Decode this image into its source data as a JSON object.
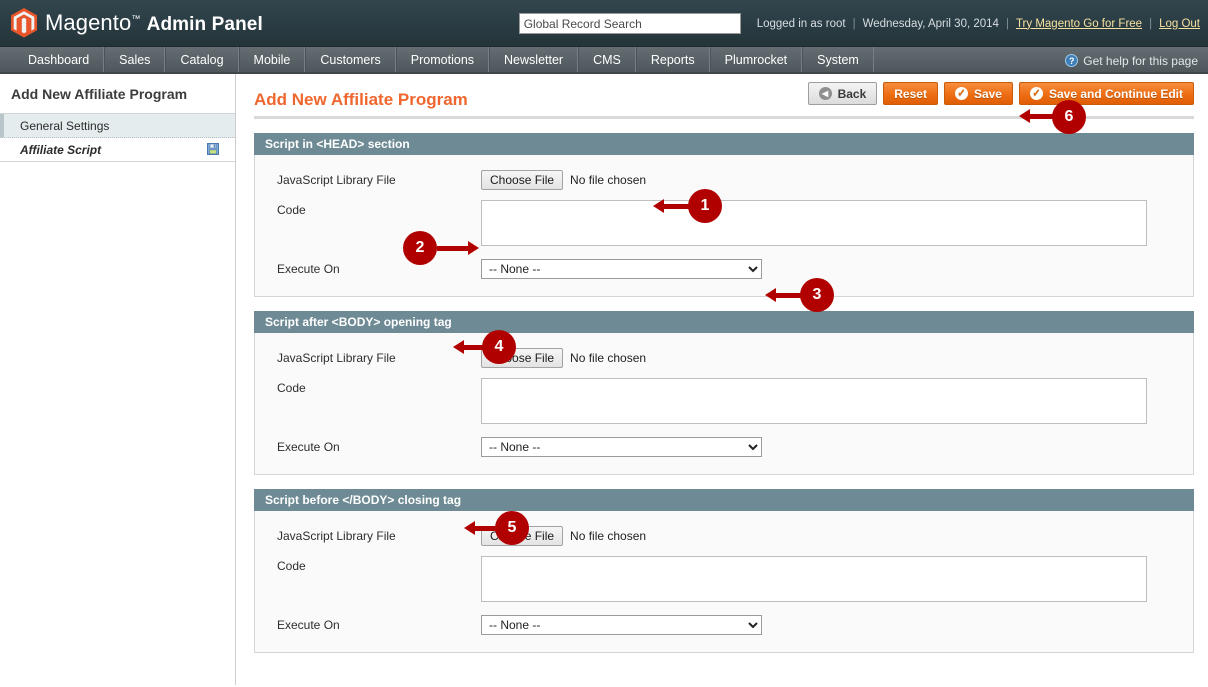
{
  "header": {
    "logo_text_brand": "Magento",
    "logo_tm": "™",
    "logo_text_sub": "Admin Panel",
    "search_placeholder": "Global Record Search",
    "search_value": "Global Record Search",
    "logged_in": "Logged in as root",
    "separator": "|",
    "date": "Wednesday, April 30, 2014",
    "try_link": "Try Magento Go for Free",
    "logout_link": "Log Out"
  },
  "nav": {
    "items": [
      {
        "label": "Dashboard"
      },
      {
        "label": "Sales"
      },
      {
        "label": "Catalog"
      },
      {
        "label": "Mobile"
      },
      {
        "label": "Customers"
      },
      {
        "label": "Promotions"
      },
      {
        "label": "Newsletter"
      },
      {
        "label": "CMS"
      },
      {
        "label": "Reports"
      },
      {
        "label": "Plumrocket"
      },
      {
        "label": "System"
      }
    ],
    "help_label": "Get help for this page",
    "help_icon": "question-mark-icon"
  },
  "sidebar": {
    "title": "Add New Affiliate Program",
    "items": [
      {
        "label": "General Settings",
        "state": "active"
      },
      {
        "label": "Affiliate Script",
        "state": "current",
        "icon": "save-disk-icon"
      }
    ]
  },
  "page": {
    "title": "Add New Affiliate Program",
    "buttons": [
      {
        "label": "Back",
        "style": "grey",
        "icon": "back-arrow-icon"
      },
      {
        "label": "Reset",
        "style": "orange",
        "icon": "none"
      },
      {
        "label": "Save",
        "style": "orange",
        "icon": "check-circle-icon"
      },
      {
        "label": "Save and Continue Edit",
        "style": "orange",
        "icon": "check-circle-icon"
      }
    ]
  },
  "fieldsets": [
    {
      "heading": "Script in <HEAD> section",
      "rows": [
        {
          "label": "JavaScript Library File",
          "type": "file",
          "button": "Choose File",
          "status": "No file chosen"
        },
        {
          "label": "Code",
          "type": "textarea",
          "value": ""
        },
        {
          "label": "Execute On",
          "type": "select",
          "value": "-- None --",
          "options": [
            "-- None --"
          ]
        }
      ]
    },
    {
      "heading": "Script after <BODY> opening tag",
      "rows": [
        {
          "label": "JavaScript Library File",
          "type": "file",
          "button": "Choose File",
          "status": "No file chosen"
        },
        {
          "label": "Code",
          "type": "textarea",
          "value": ""
        },
        {
          "label": "Execute On",
          "type": "select",
          "value": "-- None --",
          "options": [
            "-- None --"
          ]
        }
      ]
    },
    {
      "heading": "Script before </BODY> closing tag",
      "rows": [
        {
          "label": "JavaScript Library File",
          "type": "file",
          "button": "Choose File",
          "status": "No file chosen"
        },
        {
          "label": "Code",
          "type": "textarea",
          "value": ""
        },
        {
          "label": "Execute On",
          "type": "select",
          "value": "-- None --",
          "options": [
            "-- None --"
          ]
        }
      ]
    }
  ],
  "annotations": {
    "color": "#b10000",
    "markers": [
      {
        "number": "1",
        "target": "head-js-library-file"
      },
      {
        "number": "2",
        "target": "head-code-textarea"
      },
      {
        "number": "3",
        "target": "head-execute-on-select"
      },
      {
        "number": "4",
        "target": "body-open-fieldset-heading"
      },
      {
        "number": "5",
        "target": "body-close-fieldset-heading"
      },
      {
        "number": "6",
        "target": "save-button"
      }
    ]
  }
}
